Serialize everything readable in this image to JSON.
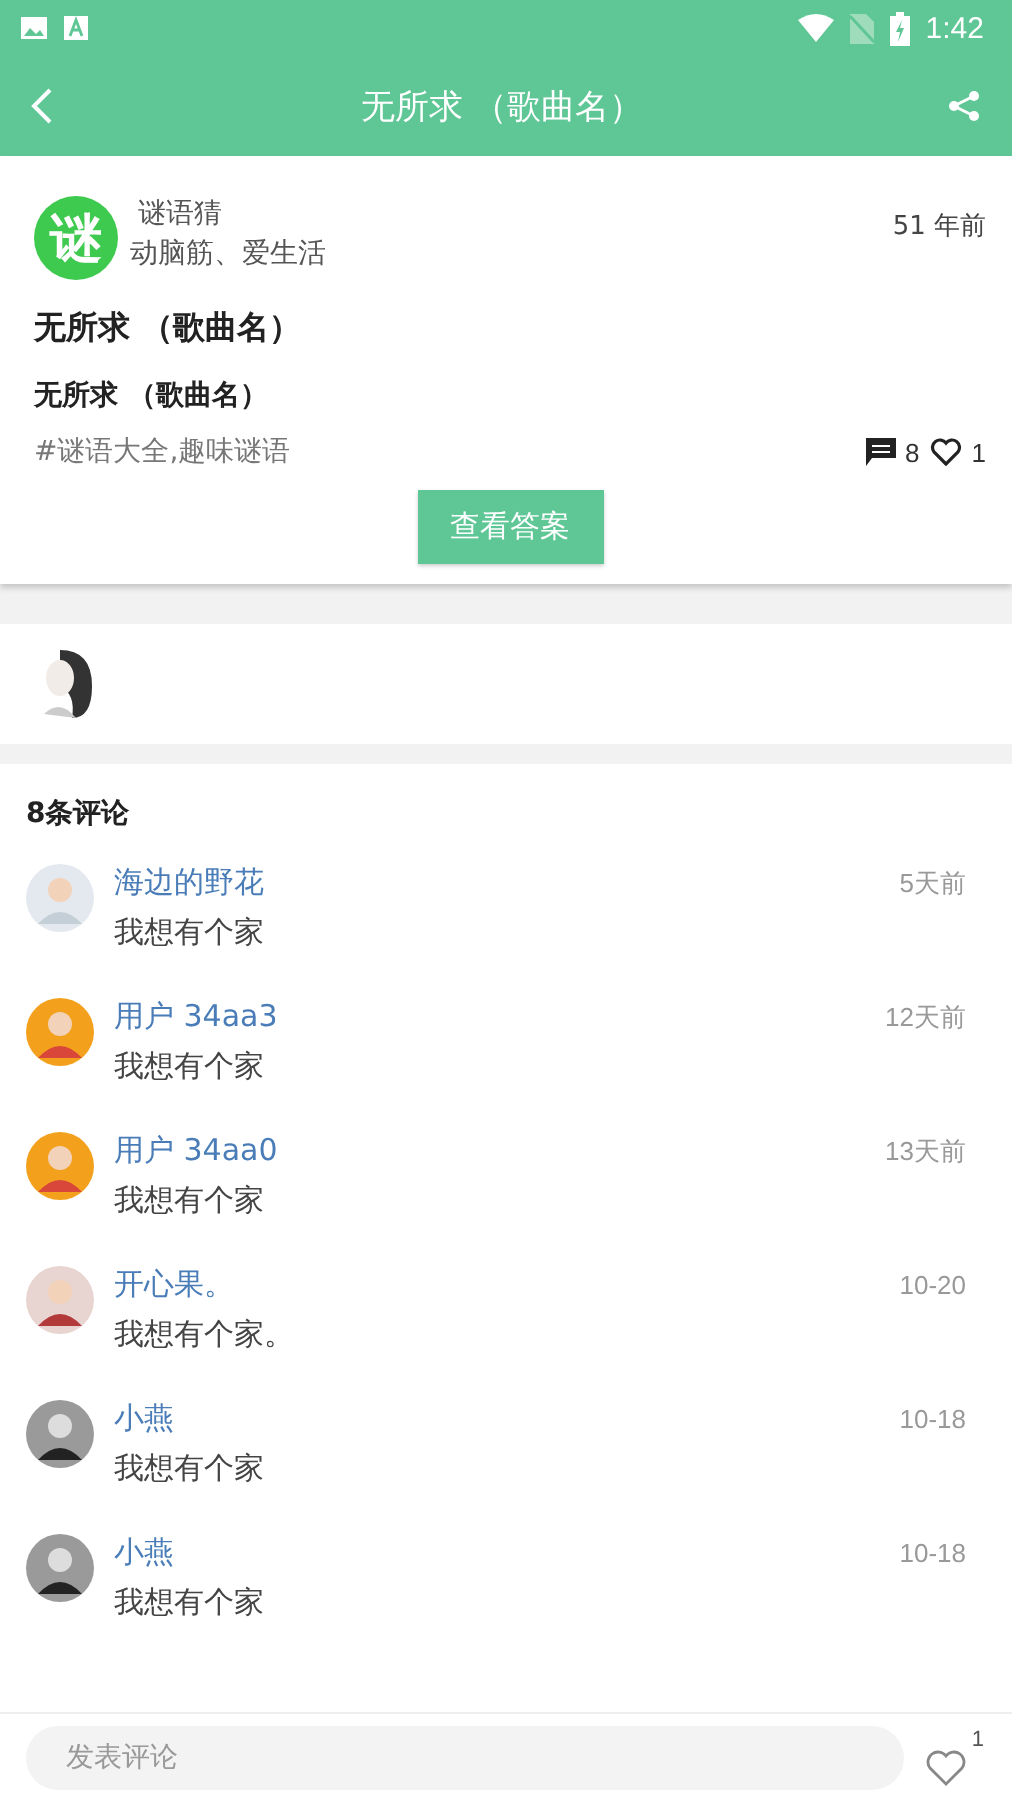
{
  "status_bar": {
    "time": "1:42"
  },
  "app_bar": {
    "title": "无所求 （歌曲名）"
  },
  "post": {
    "logo_text": "谜",
    "author": "谜语猜",
    "tagline": "动脑筋、爱生活",
    "time": "51 年前",
    "title": "无所求 （歌曲名）",
    "subtitle": "无所求 （歌曲名）",
    "tags": "#谜语大全,趣味谜语",
    "comment_count": "8",
    "like_count": "1",
    "answer_button": "查看答案"
  },
  "comments_header": "8条评论",
  "comments": [
    {
      "name": "海边的野花",
      "time": "5天前",
      "text": "我想有个家",
      "kind": "landscape"
    },
    {
      "name": "用户 34aa3",
      "time": "12天前",
      "text": "我想有个家",
      "kind": "cartoon"
    },
    {
      "name": "用户 34aa0",
      "time": "13天前",
      "text": "我想有个家",
      "kind": "cartoon"
    },
    {
      "name": "开心果。",
      "time": "10-20",
      "text": "我想有个家。",
      "kind": "photo"
    },
    {
      "name": "小燕",
      "time": "10-18",
      "text": "我想有个家",
      "kind": "dark"
    },
    {
      "name": "小燕",
      "time": "10-18",
      "text": "我想有个家",
      "kind": "dark"
    }
  ],
  "comment_input": {
    "placeholder": "发表评论"
  },
  "like_badge": "1"
}
